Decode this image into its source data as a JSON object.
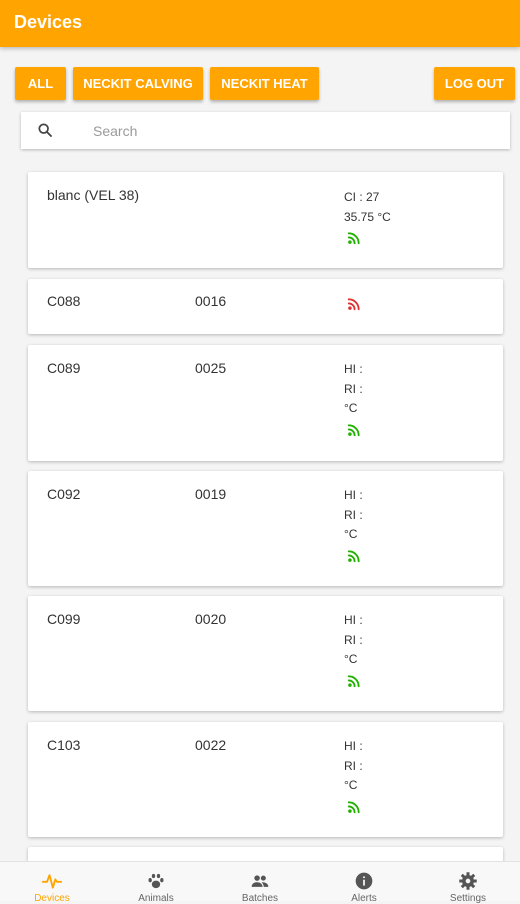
{
  "app_bar": {
    "title": "Devices"
  },
  "filters": {
    "all_label": "ALL",
    "calving_label": "NECKIT CALVING",
    "heat_label": "NECKIT HEAT",
    "logout_label": "LOG OUT"
  },
  "search": {
    "placeholder": "Search",
    "value": ""
  },
  "devices": [
    {
      "name": "blanc (VEL 38)",
      "serial": "",
      "info": [
        "CI : 27",
        "35.75 °C"
      ],
      "signal": "green"
    },
    {
      "name": "C088",
      "serial": "0016",
      "info": [],
      "signal": "red"
    },
    {
      "name": "C089",
      "serial": "0025",
      "info": [
        "HI :",
        "RI :",
        "°C"
      ],
      "signal": "green"
    },
    {
      "name": "C092",
      "serial": "0019",
      "info": [
        "HI :",
        "RI :",
        "°C"
      ],
      "signal": "green"
    },
    {
      "name": "C099",
      "serial": "0020",
      "info": [
        "HI :",
        "RI :",
        "°C"
      ],
      "signal": "green"
    },
    {
      "name": "C103",
      "serial": "0022",
      "info": [
        "HI :",
        "RI :",
        "°C"
      ],
      "signal": "green"
    }
  ],
  "bottom_nav": [
    {
      "label": "Devices",
      "icon": "pulse-icon",
      "active": true
    },
    {
      "label": "Animals",
      "icon": "paw-icon",
      "active": false
    },
    {
      "label": "Batches",
      "icon": "group-icon",
      "active": false
    },
    {
      "label": "Alerts",
      "icon": "info-icon",
      "active": false
    },
    {
      "label": "Settings",
      "icon": "gear-icon",
      "active": false
    }
  ],
  "colors": {
    "accent": "#ffa400",
    "signal_green": "#21b000",
    "signal_red": "#e03030"
  }
}
